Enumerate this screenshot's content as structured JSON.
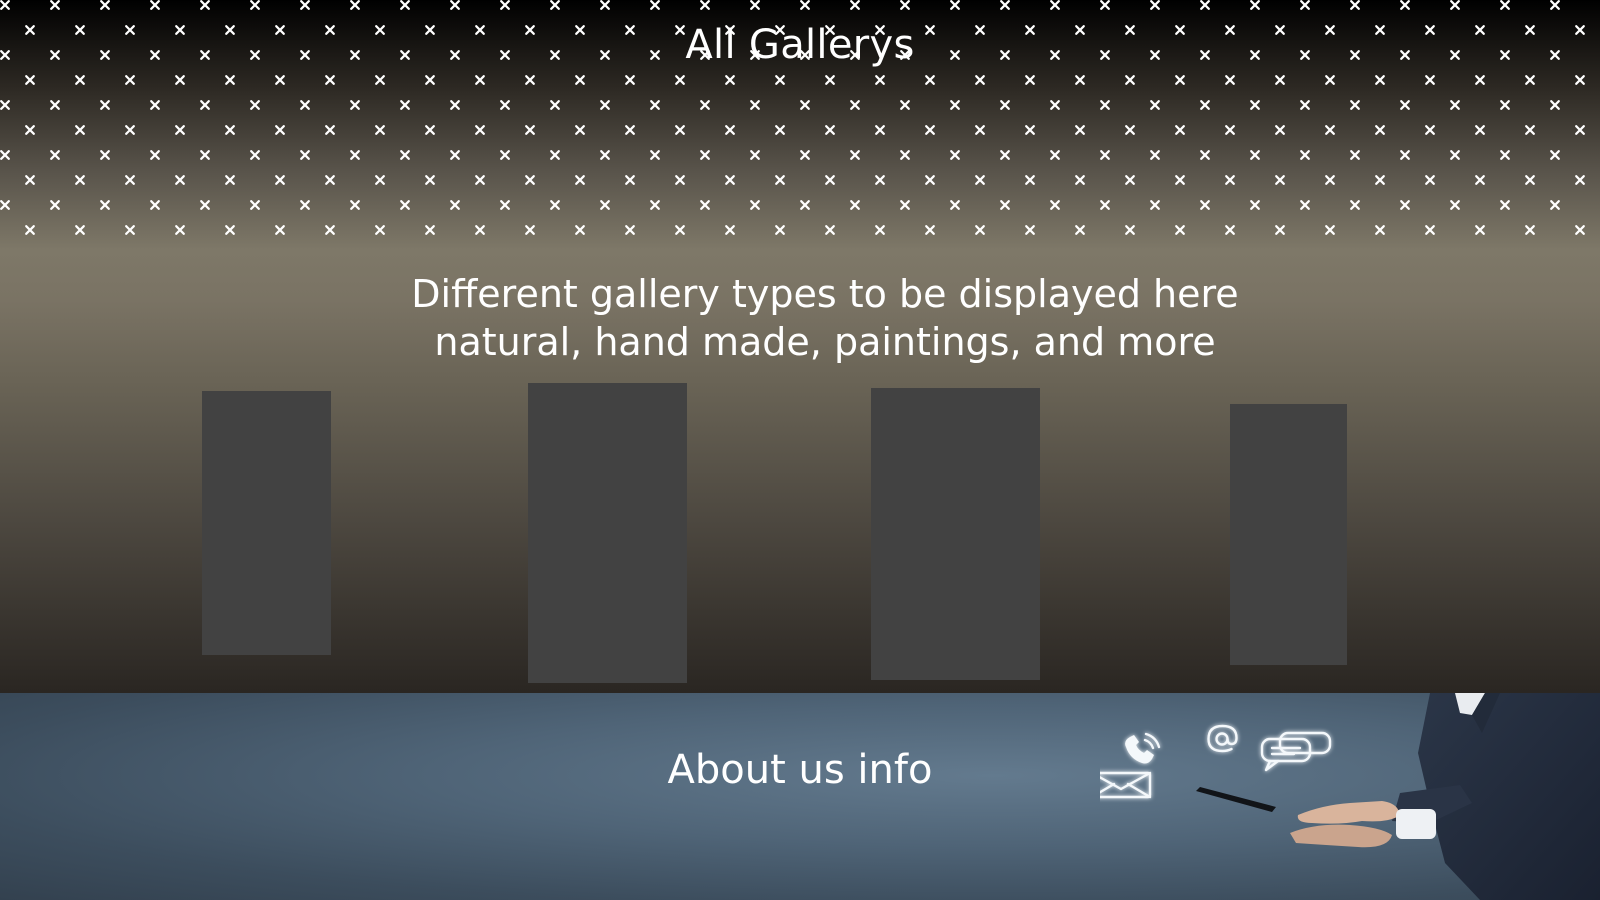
{
  "header": {
    "title": "All Gallerys"
  },
  "hero": {
    "description_line1": "Different gallery types to be displayed here",
    "description_line2": "natural, hand made, paintings, and more"
  },
  "gallery": {
    "cards": [
      {
        "label": ""
      },
      {
        "label": ""
      },
      {
        "label": ""
      },
      {
        "label": ""
      }
    ]
  },
  "about": {
    "title": "About us info",
    "icons": [
      "phone-icon",
      "at-sign-icon",
      "chat-bubbles-icon",
      "envelope-icon"
    ]
  },
  "colors": {
    "card": "#424242",
    "text": "#ffffff",
    "about_bg": "#4f6477"
  }
}
